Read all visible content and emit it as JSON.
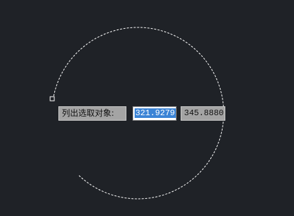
{
  "prompt": {
    "label": "列出选取对象:"
  },
  "coordinates": {
    "x_value": "321.9279",
    "y_value": "345.8880"
  },
  "canvas": {
    "background_color": "#1f2227",
    "arc_color": "#ffffff",
    "grip_color": "#ffffff",
    "selection_highlight_color": "#3b84d6"
  }
}
